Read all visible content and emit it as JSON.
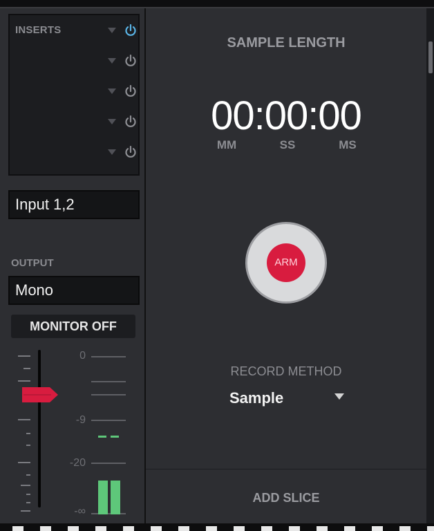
{
  "inserts": {
    "label": "INSERTS",
    "slots": [
      {
        "power": "on"
      },
      {
        "power": "off"
      },
      {
        "power": "off"
      },
      {
        "power": "off"
      },
      {
        "power": "off"
      }
    ]
  },
  "input": {
    "value": "Input 1,2"
  },
  "output": {
    "label": "OUTPUT",
    "value": "Mono"
  },
  "monitor": {
    "label": "MONITOR OFF"
  },
  "meter": {
    "labels": [
      "0",
      "-9",
      "-20",
      "-∞"
    ],
    "left_level": 0.22,
    "right_level": 0.22
  },
  "sample_length": {
    "title": "SAMPLE LENGTH",
    "time": "00:00:00",
    "units": [
      "MM",
      "SS",
      "MS"
    ]
  },
  "arm": {
    "label": "ARM"
  },
  "record_method": {
    "label": "RECORD METHOD",
    "value": "Sample"
  },
  "add_slice": {
    "label": "ADD SLICE"
  },
  "colors": {
    "accent_power_on": "#5ab4e6",
    "arm_red": "#d81c3f",
    "meter_green": "#5ec77a"
  },
  "icons": [
    "power-icon",
    "dropdown-arrow-icon",
    "fader-knob-icon"
  ]
}
